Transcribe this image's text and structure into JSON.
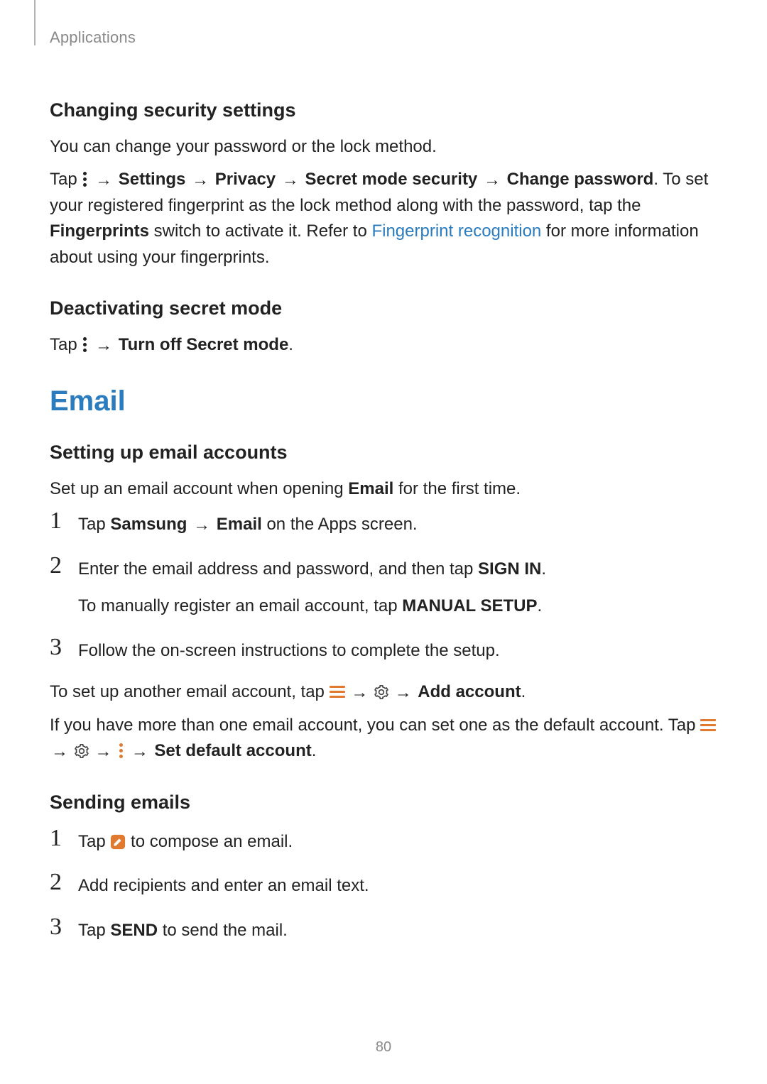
{
  "header": {
    "label": "Applications"
  },
  "section_changing": {
    "title": "Changing security settings",
    "intro": "You can change your password or the lock method.",
    "p2_pre": "Tap ",
    "p2_path1": "Settings",
    "p2_path2": "Privacy",
    "p2_path3": "Secret mode security",
    "p2_path4": "Change password",
    "p2_afterpath": ". To set your registered fingerprint as the lock method along with the password, tap the ",
    "p2_fingerprints": "Fingerprints",
    "p2_after_fp": " switch to activate it. Refer to ",
    "p2_link": "Fingerprint recognition",
    "p2_tail": " for more information about using your fingerprints."
  },
  "section_deactivate": {
    "title": "Deactivating secret mode",
    "p_pre": "Tap ",
    "p_bold": "Turn off Secret mode",
    "p_tail": "."
  },
  "section_email": {
    "heading": "Email",
    "setup_title": "Setting up email accounts",
    "setup_intro_pre": "Set up an email account when opening ",
    "setup_intro_bold": "Email",
    "setup_intro_post": " for the first time.",
    "steps": [
      {
        "num": "1",
        "pre": "Tap ",
        "b1": "Samsung",
        "b2": "Email",
        "post": " on the Apps screen."
      },
      {
        "num": "2",
        "line1_pre": "Enter the email address and password, and then tap ",
        "line1_b": "SIGN IN",
        "line1_post": ".",
        "line2_pre": "To manually register an email account, tap ",
        "line2_b": "MANUAL SETUP",
        "line2_post": "."
      },
      {
        "num": "3",
        "text": "Follow the on-screen instructions to complete the setup."
      }
    ],
    "another_pre": "To set up another email account, tap ",
    "another_b": "Add account",
    "another_post": ".",
    "default_pre": "If you have more than one email account, you can set one as the default account. Tap ",
    "default_b": "Set default account",
    "default_post": "."
  },
  "section_sending": {
    "title": "Sending emails",
    "steps": [
      {
        "num": "1",
        "pre": "Tap ",
        "post": " to compose an email."
      },
      {
        "num": "2",
        "text": "Add recipients and enter an email text."
      },
      {
        "num": "3",
        "pre": "Tap ",
        "b": "SEND",
        "post": " to send the mail."
      }
    ]
  },
  "arrows": {
    "right": "→"
  },
  "page_number": "80"
}
